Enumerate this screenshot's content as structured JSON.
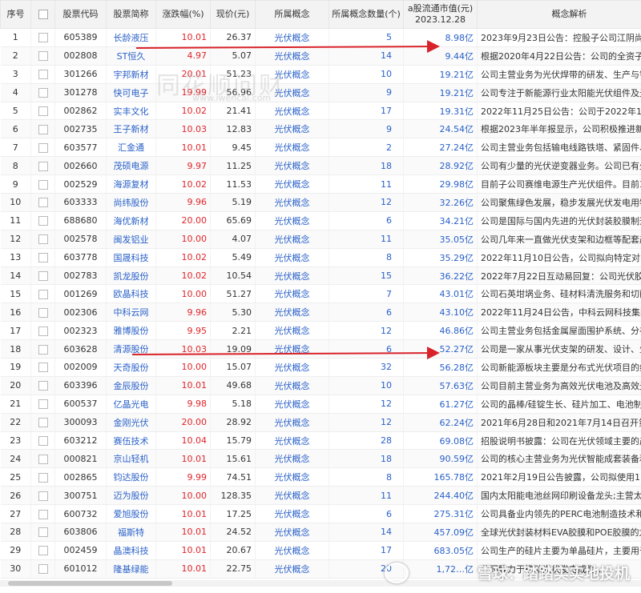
{
  "headers": {
    "idx": "序号",
    "code": "股票代码",
    "name": "股票简称",
    "change": "涨跌幅(%)",
    "price": "现价(元)",
    "concept": "所属概念",
    "concept_count": "所属概念数量(个)",
    "mcap_line1": "a股流通市值(元)",
    "mcap_line2": "2023.12.28",
    "desc": "概念解析"
  },
  "watermark": "同花顺问财",
  "watermark_sub": "www.iwencai.com",
  "credit": "雪球：踏踏实实地投机",
  "colors": {
    "up": "#e0262b",
    "link": "#2a61c9",
    "arrow": "#d9232a"
  },
  "rows": [
    {
      "idx": "1",
      "code": "605389",
      "name": "长龄液压",
      "change": "10.01",
      "price": "26.37",
      "concept": "光伏概念",
      "count": "5",
      "mcap": "8.98亿",
      "desc": "2023年9月23日公告：控股子公司江阴尚驰是…"
    },
    {
      "idx": "2",
      "code": "002808",
      "name": "ST恒久",
      "change": "4.97",
      "price": "5.07",
      "concept": "光伏概念",
      "count": "14",
      "mcap": "9.44亿",
      "desc": "根据2020年4月22日公告：公司的全资子公…"
    },
    {
      "idx": "3",
      "code": "301266",
      "name": "宇邦新材",
      "change": "20.01",
      "price": "51.23",
      "concept": "光伏概念",
      "count": "10",
      "mcap": "19.21亿",
      "desc": "公司主营业务为光伏焊带的研发、生产与销售…"
    },
    {
      "idx": "4",
      "code": "301278",
      "name": "快可电子",
      "change": "19.99",
      "price": "56.96",
      "concept": "光伏概念",
      "count": "9",
      "mcap": "19.21亿",
      "desc": "公司专注于新能源行业太阳能光伏组件及光伏…"
    },
    {
      "idx": "5",
      "code": "002862",
      "name": "实丰文化",
      "change": "10.02",
      "price": "21.41",
      "concept": "光伏概念",
      "count": "17",
      "mcap": "19.31亿",
      "desc": "2022年11月25日公告：公司于2022年11月25…"
    },
    {
      "idx": "6",
      "code": "002735",
      "name": "王子新材",
      "change": "10.03",
      "price": "12.83",
      "concept": "光伏概念",
      "count": "9",
      "mcap": "24.54亿",
      "desc": "根据2023年半年报显示，公司积极推进新能源…"
    },
    {
      "idx": "7",
      "code": "603577",
      "name": "汇金通",
      "change": "10.01",
      "price": "9.45",
      "concept": "光伏概念",
      "count": "2",
      "mcap": "27.24亿",
      "desc": "公司主营业务包括输电线路铁塔、紧固件、通…"
    },
    {
      "idx": "8",
      "code": "002660",
      "name": "茂硕电源",
      "change": "9.97",
      "price": "11.25",
      "concept": "光伏概念",
      "count": "18",
      "mcap": "28.92亿",
      "desc": "公司有少量的光伏逆变器业务。公司已有少量…"
    },
    {
      "idx": "9",
      "code": "002529",
      "name": "海源复材",
      "change": "10.02",
      "price": "11.53",
      "concept": "光伏概念",
      "count": "11",
      "mcap": "29.98亿",
      "desc": "目前子公司赛维电源生产光伏组件。目前375M…"
    },
    {
      "idx": "10",
      "code": "603333",
      "name": "尚纬股份",
      "change": "9.96",
      "price": "5.19",
      "concept": "光伏概念",
      "count": "12",
      "mcap": "32.26亿",
      "desc": "公司聚焦绿色发展，稳步发展光伏发电用特种…"
    },
    {
      "idx": "11",
      "code": "688680",
      "name": "海优新材",
      "change": "20.00",
      "price": "65.69",
      "concept": "光伏概念",
      "count": "6",
      "mcap": "34.21亿",
      "desc": "公司是国际与国内先进的光伏封装胶膜制造商…"
    },
    {
      "idx": "12",
      "code": "002578",
      "name": "闽发铝业",
      "change": "10.00",
      "price": "4.07",
      "concept": "光伏概念",
      "count": "11",
      "mcap": "35.05亿",
      "desc": "公司几年来一直做光伏支架和边框等配套产品…"
    },
    {
      "idx": "13",
      "code": "603778",
      "name": "国晟科技",
      "change": "10.02",
      "price": "5.49",
      "concept": "光伏概念",
      "count": "8",
      "mcap": "35.29亿",
      "desc": "2022年11月10日公告，公司拟向特定对象发行…"
    },
    {
      "idx": "14",
      "code": "002783",
      "name": "凯龙股份",
      "change": "10.02",
      "price": "10.54",
      "concept": "光伏概念",
      "count": "15",
      "mcap": "36.22亿",
      "desc": "2022年7月22日互动易回复：公司光伏胶结系…"
    },
    {
      "idx": "15",
      "code": "001269",
      "name": "欧晶科技",
      "change": "10.00",
      "price": "51.27",
      "concept": "光伏概念",
      "count": "7",
      "mcap": "43.01亿",
      "desc": "公司石英坩埚业务、硅材料清洗服务和切削液…"
    },
    {
      "idx": "16",
      "code": "002306",
      "name": "中科云网",
      "change": "9.96",
      "price": "5.30",
      "concept": "光伏概念",
      "count": "6",
      "mcap": "43.10亿",
      "desc": "2022年11月24日公告，中科云网科技集团股份…"
    },
    {
      "idx": "17",
      "code": "002323",
      "name": "雅博股份",
      "change": "9.95",
      "price": "2.21",
      "concept": "光伏概念",
      "count": "12",
      "mcap": "46.86亿",
      "desc": "公司主营业务包括金属屋面围护系统、分布式…"
    },
    {
      "idx": "18",
      "code": "603628",
      "name": "清源股份",
      "change": "10.03",
      "price": "19.09",
      "concept": "光伏概念",
      "count": "6",
      "mcap": "52.27亿",
      "desc": "公司是一家从事光伏支架的研发、设计、生产…"
    },
    {
      "idx": "19",
      "code": "002009",
      "name": "天奇股份",
      "change": "10.00",
      "price": "15.07",
      "concept": "光伏概念",
      "count": "32",
      "mcap": "56.28亿",
      "desc": "公司新能源板块主要是分布式光伏项目的综合…"
    },
    {
      "idx": "20",
      "code": "603396",
      "name": "金辰股份",
      "change": "10.01",
      "price": "49.68",
      "concept": "光伏概念",
      "count": "10",
      "mcap": "57.63亿",
      "desc": "公司目前主营业务为高效光伏电池及高效光伏…"
    },
    {
      "idx": "21",
      "code": "600537",
      "name": "亿晶光电",
      "change": "9.98",
      "price": "5.18",
      "concept": "光伏概念",
      "count": "12",
      "mcap": "61.27亿",
      "desc": "公司的晶棒/硅锭生长、硅片加工、电池制造业…"
    },
    {
      "idx": "22",
      "code": "300093",
      "name": "金刚光伏",
      "change": "20.00",
      "price": "28.92",
      "concept": "光伏概念",
      "count": "12",
      "mcap": "62.24亿",
      "desc": "2021年6月28日和2021年7月14日召开第七届…"
    },
    {
      "idx": "23",
      "code": "603212",
      "name": "赛伍技术",
      "change": "10.04",
      "price": "15.79",
      "concept": "光伏概念",
      "count": "28",
      "mcap": "69.08亿",
      "desc": "招股说明书披露：公司在光伏领域主要的产品…"
    },
    {
      "idx": "24",
      "code": "000821",
      "name": "京山轻机",
      "change": "10.01",
      "price": "15.61",
      "concept": "光伏概念",
      "count": "18",
      "mcap": "90.59亿",
      "desc": "公司的核心主营业务为光伏智能成套装备和包…"
    },
    {
      "idx": "25",
      "code": "002865",
      "name": "钧达股份",
      "change": "9.99",
      "price": "74.51",
      "concept": "光伏概念",
      "count": "8",
      "mcap": "165.78亿",
      "desc": "2021年2月19日公告披露，公司拟使用1.5亿元…"
    },
    {
      "idx": "26",
      "code": "300751",
      "name": "迈为股份",
      "change": "10.00",
      "price": "128.35",
      "concept": "光伏概念",
      "count": "11",
      "mcap": "244.40亿",
      "desc": "国内太阳能电池丝网印刷设备龙头;主营太阳能…"
    },
    {
      "idx": "27",
      "code": "600732",
      "name": "爱旭股份",
      "change": "10.01",
      "price": "17.25",
      "concept": "光伏概念",
      "count": "6",
      "mcap": "275.31亿",
      "desc": "公司具备业内领先的PERC电池制造技术和生…"
    },
    {
      "idx": "28",
      "code": "603806",
      "name": "福斯特",
      "change": "10.01",
      "price": "24.52",
      "concept": "光伏概念",
      "count": "14",
      "mcap": "457.09亿",
      "desc": "全球光伏封装材料EVA胶膜和POE胶膜的龙头,E…"
    },
    {
      "idx": "29",
      "code": "002459",
      "name": "晶澳科技",
      "change": "10.01",
      "price": "20.67",
      "concept": "光伏概念",
      "count": "17",
      "mcap": "683.05亿",
      "desc": "公司生产的硅片主要为单晶硅片，主要用于加…"
    },
    {
      "idx": "30",
      "code": "601012",
      "name": "隆基绿能",
      "change": "10.01",
      "price": "22.75",
      "concept": "光伏概念",
      "count": "20",
      "mcap": "1,72…亿",
      "desc": "公司致力于推动光伏发电成为…"
    }
  ]
}
